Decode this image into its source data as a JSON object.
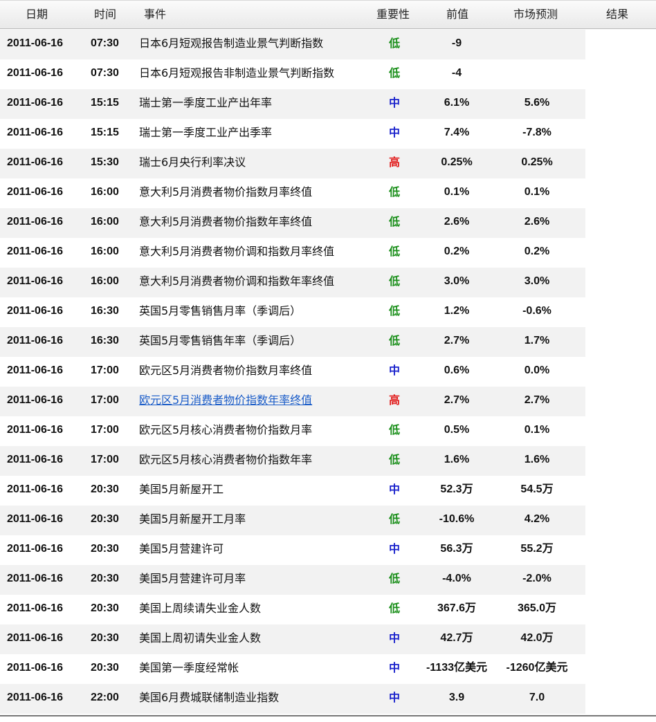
{
  "header": {
    "date": "日期",
    "time": "时间",
    "event": "事件",
    "importance": "重要性",
    "previous": "前值",
    "forecast": "市场预测",
    "result": "结果"
  },
  "colors": {
    "low": "#1a8f1a",
    "mid": "#1a22cc",
    "high": "#e11d1d",
    "link": "#1a5cc8"
  },
  "rows": [
    {
      "date": "2011-06-16",
      "time": "07:30",
      "event": "日本6月短观报告制造业景气判断指数",
      "importance": "低",
      "level": "low",
      "previous": "-9",
      "forecast": ""
    },
    {
      "date": "2011-06-16",
      "time": "07:30",
      "event": "日本6月短观报告非制造业景气判断指数",
      "importance": "低",
      "level": "low",
      "previous": "-4",
      "forecast": ""
    },
    {
      "date": "2011-06-16",
      "time": "15:15",
      "event": "瑞士第一季度工业产出年率",
      "importance": "中",
      "level": "mid",
      "previous": "6.1%",
      "forecast": "5.6%"
    },
    {
      "date": "2011-06-16",
      "time": "15:15",
      "event": "瑞士第一季度工业产出季率",
      "importance": "中",
      "level": "mid",
      "previous": "7.4%",
      "forecast": "-7.8%"
    },
    {
      "date": "2011-06-16",
      "time": "15:30",
      "event": "瑞士6月央行利率决议",
      "importance": "高",
      "level": "high",
      "previous": "0.25%",
      "forecast": "0.25%"
    },
    {
      "date": "2011-06-16",
      "time": "16:00",
      "event": "意大利5月消费者物价指数月率终值",
      "importance": "低",
      "level": "low",
      "previous": "0.1%",
      "forecast": "0.1%"
    },
    {
      "date": "2011-06-16",
      "time": "16:00",
      "event": "意大利5月消费者物价指数年率终值",
      "importance": "低",
      "level": "low",
      "previous": "2.6%",
      "forecast": "2.6%"
    },
    {
      "date": "2011-06-16",
      "time": "16:00",
      "event": "意大利5月消费者物价调和指数月率终值",
      "importance": "低",
      "level": "low",
      "previous": "0.2%",
      "forecast": "0.2%"
    },
    {
      "date": "2011-06-16",
      "time": "16:00",
      "event": "意大利5月消费者物价调和指数年率终值",
      "importance": "低",
      "level": "low",
      "previous": "3.0%",
      "forecast": "3.0%"
    },
    {
      "date": "2011-06-16",
      "time": "16:30",
      "event": "英国5月零售销售月率（季调后）",
      "importance": "低",
      "level": "low",
      "previous": "1.2%",
      "forecast": "-0.6%"
    },
    {
      "date": "2011-06-16",
      "time": "16:30",
      "event": "英国5月零售销售年率（季调后）",
      "importance": "低",
      "level": "low",
      "previous": "2.7%",
      "forecast": "1.7%"
    },
    {
      "date": "2011-06-16",
      "time": "17:00",
      "event": "欧元区5月消费者物价指数月率终值",
      "importance": "中",
      "level": "mid",
      "previous": "0.6%",
      "forecast": "0.0%"
    },
    {
      "date": "2011-06-16",
      "time": "17:00",
      "event": "欧元区5月消费者物价指数年率终值",
      "importance": "高",
      "level": "high",
      "previous": "2.7%",
      "forecast": "2.7%",
      "link": true
    },
    {
      "date": "2011-06-16",
      "time": "17:00",
      "event": "欧元区5月核心消费者物价指数月率",
      "importance": "低",
      "level": "low",
      "previous": "0.5%",
      "forecast": "0.1%"
    },
    {
      "date": "2011-06-16",
      "time": "17:00",
      "event": "欧元区5月核心消费者物价指数年率",
      "importance": "低",
      "level": "low",
      "previous": "1.6%",
      "forecast": "1.6%"
    },
    {
      "date": "2011-06-16",
      "time": "20:30",
      "event": "美国5月新屋开工",
      "importance": "中",
      "level": "mid",
      "previous": "52.3万",
      "forecast": "54.5万"
    },
    {
      "date": "2011-06-16",
      "time": "20:30",
      "event": "美国5月新屋开工月率",
      "importance": "低",
      "level": "low",
      "previous": "-10.6%",
      "forecast": "4.2%"
    },
    {
      "date": "2011-06-16",
      "time": "20:30",
      "event": "美国5月营建许可",
      "importance": "中",
      "level": "mid",
      "previous": "56.3万",
      "forecast": "55.2万"
    },
    {
      "date": "2011-06-16",
      "time": "20:30",
      "event": "美国5月营建许可月率",
      "importance": "低",
      "level": "low",
      "previous": "-4.0%",
      "forecast": "-2.0%"
    },
    {
      "date": "2011-06-16",
      "time": "20:30",
      "event": "美国上周续请失业金人数",
      "importance": "低",
      "level": "low",
      "previous": "367.6万",
      "forecast": "365.0万"
    },
    {
      "date": "2011-06-16",
      "time": "20:30",
      "event": "美国上周初请失业金人数",
      "importance": "中",
      "level": "mid",
      "previous": "42.7万",
      "forecast": "42.0万"
    },
    {
      "date": "2011-06-16",
      "time": "20:30",
      "event": "美国第一季度经常帐",
      "importance": "中",
      "level": "mid",
      "previous": "-1133亿美元",
      "forecast": "-1260亿美元"
    },
    {
      "date": "2011-06-16",
      "time": "22:00",
      "event": "美国6月费城联储制造业指数",
      "importance": "中",
      "level": "mid",
      "previous": "3.9",
      "forecast": "7.0"
    }
  ]
}
